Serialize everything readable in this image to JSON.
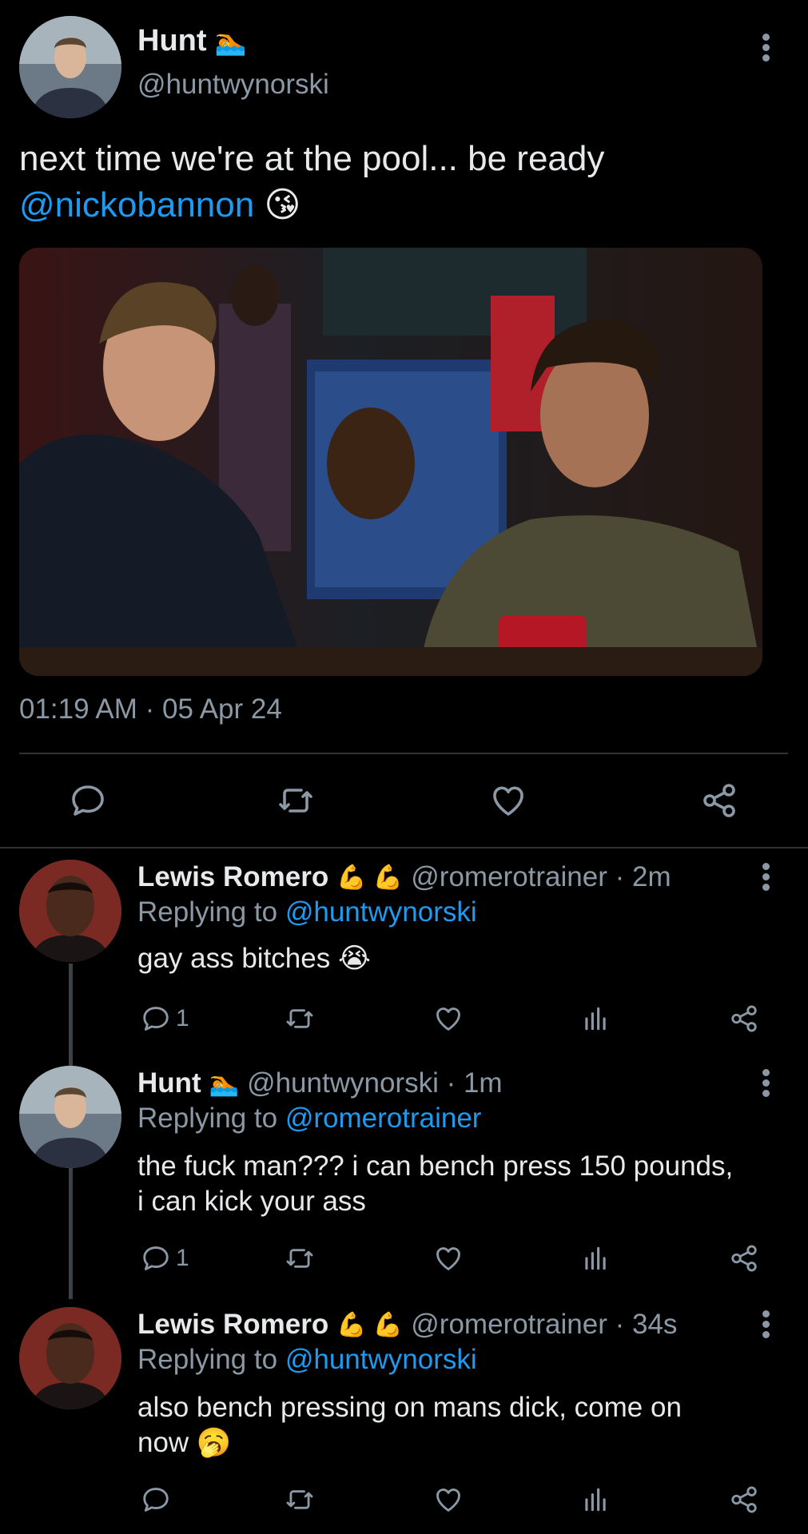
{
  "main_tweet": {
    "author_name": "Hunt",
    "author_emoji": "🏊",
    "handle": "@huntwynorski",
    "text_line1": "next time we're at the pool... be ready",
    "mention": "@nickobannon",
    "mention_emoji": "😘",
    "timestamp": "01:19 AM · 05 Apr 24"
  },
  "replies": [
    {
      "author_name": "Lewis Romero",
      "author_emoji": "💪 💪",
      "handle_time": "@romerotrainer · 2m",
      "replying_prefix": "Replying to",
      "replying_to": "@huntwynorski",
      "text_lines": [
        "gay ass bitches 😭"
      ],
      "reply_count": "1"
    },
    {
      "author_name": "Hunt",
      "author_emoji": "🏊",
      "handle_time": "@huntwynorski · 1m",
      "replying_prefix": "Replying to",
      "replying_to": "@romerotrainer",
      "text_lines": [
        "the fuck man??? i can bench press 150 pounds,",
        "i can kick your ass"
      ],
      "reply_count": "1"
    },
    {
      "author_name": "Lewis Romero",
      "author_emoji": "💪 💪",
      "handle_time": "@romerotrainer · 34s",
      "replying_prefix": "Replying to",
      "replying_to": "@huntwynorski",
      "text_lines": [
        "also bench pressing on mans dick, come on",
        "now 🥱"
      ],
      "reply_count": ""
    }
  ],
  "colors": {
    "background": "#000000",
    "text": "#e7e9ea",
    "muted": "#8b98a5",
    "link": "#1d9bf0"
  },
  "icons": [
    "reply-icon",
    "retweet-icon",
    "like-icon",
    "share-icon",
    "analytics-icon",
    "more-icon"
  ]
}
